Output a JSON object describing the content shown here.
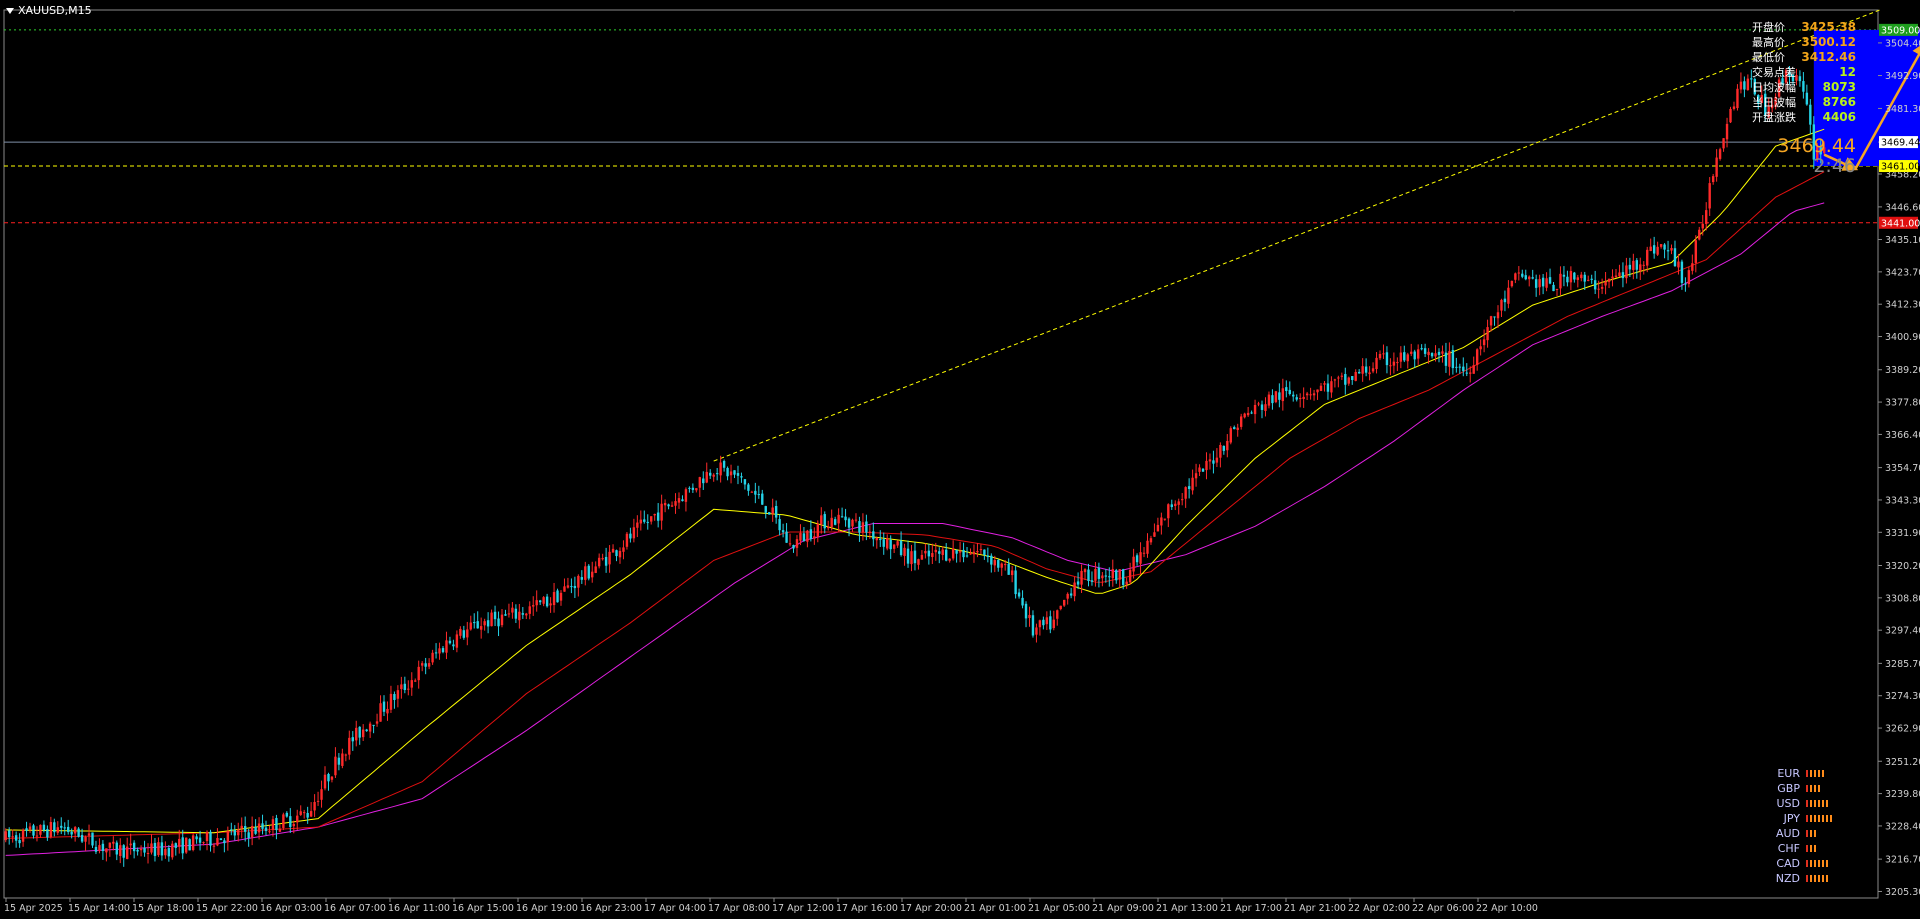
{
  "chart_title": "XAUUSD,M15",
  "info_panel": [
    {
      "label": "开盘价",
      "value": "3425.38",
      "color": "#f2a51a"
    },
    {
      "label": "最高价",
      "value": "3500.12",
      "color": "#f2a51a"
    },
    {
      "label": "最低价",
      "value": "3412.46",
      "color": "#f2a51a"
    },
    {
      "label": "交易点差",
      "value": "12",
      "color": "#b9f21a"
    },
    {
      "label": "日均波幅",
      "value": "8073",
      "color": "#b9f21a"
    },
    {
      "label": "当日波幅",
      "value": "8766",
      "color": "#b9f21a"
    },
    {
      "label": "开盘涨跌",
      "value": "4406",
      "color": "#b9f21a"
    }
  ],
  "big_price": "3469.44",
  "countdown": "2:46",
  "price_tags": {
    "top_level": "3509.00",
    "current": "3469.44",
    "support": "3461.00",
    "red_level": "3441.00"
  },
  "colors": {
    "up_candle": "#ff2a2a",
    "down_candle": "#25d3e8",
    "ma_fast": "#ffff00",
    "ma_mid": "#e01010",
    "ma_slow": "#e020e0",
    "target_box": "#0000ff",
    "arrow": "#f5a623",
    "grid_dash_green": "#2ed12e",
    "support_line": "#ffff00",
    "red_line": "#ff2020"
  },
  "currency_strength": [
    {
      "name": "EUR",
      "bars": 5
    },
    {
      "name": "GBP",
      "bars": 4
    },
    {
      "name": "USD",
      "bars": 6
    },
    {
      "name": "JPY",
      "bars": 7
    },
    {
      "name": "AUD",
      "bars": 3
    },
    {
      "name": "CHF",
      "bars": 3
    },
    {
      "name": "CAD",
      "bars": 6
    },
    {
      "name": "NZD",
      "bars": 6
    }
  ],
  "chart_data": {
    "type": "candlestick",
    "symbol": "XAUUSD",
    "timeframe": "M15",
    "ylim": [
      3203.0,
      3516.0
    ],
    "y_ticks": [
      "3504.40",
      "3492.90",
      "3481.30",
      "3469.44",
      "3458.20",
      "3446.60",
      "3435.10",
      "3423.70",
      "3412.30",
      "3400.90",
      "3389.20",
      "3377.80",
      "3366.40",
      "3354.70",
      "3343.30",
      "3331.90",
      "3320.20",
      "3308.80",
      "3297.40",
      "3285.70",
      "3274.30",
      "3262.90",
      "3251.20",
      "3239.80",
      "3228.40",
      "3216.70",
      "3205.30"
    ],
    "x_ticks": [
      "15 Apr 2025",
      "15 Apr 14:00",
      "15 Apr 18:00",
      "15 Apr 22:00",
      "16 Apr 03:00",
      "16 Apr 07:00",
      "16 Apr 11:00",
      "16 Apr 15:00",
      "16 Apr 19:00",
      "16 Apr 23:00",
      "17 Apr 04:00",
      "17 Apr 08:00",
      "17 Apr 12:00",
      "17 Apr 16:00",
      "17 Apr 20:00",
      "21 Apr 01:00",
      "21 Apr 05:00",
      "21 Apr 09:00",
      "21 Apr 13:00",
      "21 Apr 17:00",
      "21 Apr 21:00",
      "22 Apr 02:00",
      "22 Apr 06:00",
      "22 Apr 10:00"
    ],
    "price_path": [
      [
        0,
        3224
      ],
      [
        16,
        3228
      ],
      [
        30,
        3220
      ],
      [
        45,
        3220
      ],
      [
        60,
        3224
      ],
      [
        75,
        3228
      ],
      [
        87,
        3233
      ],
      [
        97,
        3255
      ],
      [
        107,
        3268
      ],
      [
        117,
        3280
      ],
      [
        127,
        3293
      ],
      [
        137,
        3300
      ],
      [
        147,
        3303
      ],
      [
        157,
        3308
      ],
      [
        167,
        3317
      ],
      [
        177,
        3327
      ],
      [
        187,
        3338
      ],
      [
        197,
        3347
      ],
      [
        204,
        3355
      ],
      [
        210,
        3352
      ],
      [
        220,
        3340
      ],
      [
        226,
        3327
      ],
      [
        236,
        3336
      ],
      [
        242,
        3337
      ],
      [
        252,
        3330
      ],
      [
        262,
        3322
      ],
      [
        272,
        3325
      ],
      [
        282,
        3325
      ],
      [
        290,
        3316
      ],
      [
        296,
        3297
      ],
      [
        302,
        3300
      ],
      [
        308,
        3315
      ],
      [
        316,
        3318
      ],
      [
        322,
        3316
      ],
      [
        328,
        3325
      ],
      [
        336,
        3342
      ],
      [
        346,
        3355
      ],
      [
        356,
        3372
      ],
      [
        366,
        3380
      ],
      [
        376,
        3382
      ],
      [
        386,
        3385
      ],
      [
        396,
        3392
      ],
      [
        406,
        3394
      ],
      [
        416,
        3393
      ],
      [
        421,
        3388
      ],
      [
        426,
        3402
      ],
      [
        431,
        3412
      ],
      [
        436,
        3423
      ],
      [
        441,
        3420
      ],
      [
        446,
        3418
      ],
      [
        451,
        3424
      ],
      [
        456,
        3419
      ],
      [
        461,
        3420
      ],
      [
        466,
        3423
      ],
      [
        471,
        3428
      ],
      [
        476,
        3433
      ],
      [
        480,
        3430
      ],
      [
        484,
        3420
      ],
      [
        488,
        3436
      ],
      [
        492,
        3460
      ],
      [
        496,
        3478
      ],
      [
        500,
        3491
      ],
      [
        504,
        3488
      ],
      [
        507,
        3481
      ],
      [
        510,
        3487
      ],
      [
        513,
        3494
      ],
      [
        516,
        3493
      ],
      [
        519,
        3481
      ],
      [
        521,
        3466
      ],
      [
        524,
        3468
      ]
    ],
    "ma_fast_points": [
      [
        0,
        3227
      ],
      [
        60,
        3226
      ],
      [
        90,
        3231
      ],
      [
        120,
        3262
      ],
      [
        150,
        3292
      ],
      [
        180,
        3317
      ],
      [
        204,
        3340
      ],
      [
        225,
        3338
      ],
      [
        245,
        3331
      ],
      [
        265,
        3328
      ],
      [
        285,
        3323
      ],
      [
        300,
        3316
      ],
      [
        315,
        3310
      ],
      [
        325,
        3314
      ],
      [
        340,
        3334
      ],
      [
        360,
        3358
      ],
      [
        380,
        3377
      ],
      [
        400,
        3387
      ],
      [
        420,
        3397
      ],
      [
        440,
        3412
      ],
      [
        460,
        3420
      ],
      [
        480,
        3427
      ],
      [
        495,
        3445
      ],
      [
        510,
        3468
      ],
      [
        524,
        3474
      ]
    ],
    "ma_mid_points": [
      [
        0,
        3224
      ],
      [
        60,
        3226
      ],
      [
        90,
        3228
      ],
      [
        120,
        3244
      ],
      [
        150,
        3275
      ],
      [
        180,
        3300
      ],
      [
        204,
        3322
      ],
      [
        225,
        3332
      ],
      [
        245,
        3332
      ],
      [
        265,
        3331
      ],
      [
        285,
        3327
      ],
      [
        300,
        3319
      ],
      [
        315,
        3314
      ],
      [
        330,
        3318
      ],
      [
        350,
        3338
      ],
      [
        370,
        3358
      ],
      [
        390,
        3372
      ],
      [
        410,
        3382
      ],
      [
        430,
        3395
      ],
      [
        450,
        3408
      ],
      [
        470,
        3418
      ],
      [
        490,
        3428
      ],
      [
        510,
        3450
      ],
      [
        524,
        3459
      ]
    ],
    "ma_slow_points": [
      [
        0,
        3218
      ],
      [
        60,
        3222
      ],
      [
        90,
        3228
      ],
      [
        120,
        3238
      ],
      [
        150,
        3262
      ],
      [
        180,
        3288
      ],
      [
        210,
        3314
      ],
      [
        230,
        3329
      ],
      [
        250,
        3335
      ],
      [
        270,
        3335
      ],
      [
        290,
        3330
      ],
      [
        306,
        3322
      ],
      [
        320,
        3318
      ],
      [
        340,
        3324
      ],
      [
        360,
        3334
      ],
      [
        380,
        3348
      ],
      [
        400,
        3364
      ],
      [
        420,
        3382
      ],
      [
        440,
        3398
      ],
      [
        460,
        3408
      ],
      [
        480,
        3417
      ],
      [
        500,
        3430
      ],
      [
        515,
        3445
      ],
      [
        524,
        3448
      ]
    ],
    "trendline": [
      [
        204,
        3357
      ],
      [
        540,
        3516
      ]
    ],
    "horizontal_levels": [
      {
        "price": 3509.0,
        "style": "dotted",
        "color": "#2ed12e"
      },
      {
        "price": 3469.44,
        "style": "solid",
        "color": "#8090a8"
      },
      {
        "price": 3461.0,
        "style": "dashed",
        "color": "#ffff00"
      },
      {
        "price": 3441.0,
        "style": "dashed",
        "color": "#ff2020"
      }
    ],
    "target_zone": {
      "x_range": [
        521,
        567
      ],
      "price_range": [
        3461.0,
        3509.0
      ]
    },
    "arrows": [
      {
        "from": [
          524,
          3465
        ],
        "to": [
          533,
          3460
        ]
      },
      {
        "from": [
          533,
          3460
        ],
        "to": [
          553,
          3504
        ]
      }
    ]
  }
}
